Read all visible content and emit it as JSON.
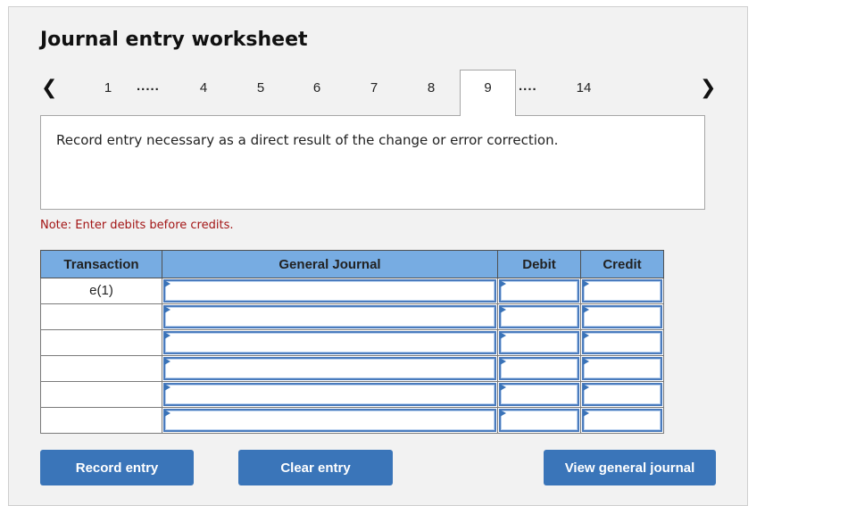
{
  "header": {
    "title": "Journal entry worksheet"
  },
  "pager": {
    "prev_icon": "chevron-left-icon",
    "next_icon": "chevron-right-icon",
    "prev_glyph": "❮",
    "next_glyph": "❯",
    "pages": [
      "1",
      "4",
      "5",
      "6",
      "7",
      "8",
      "9",
      "14"
    ],
    "dots_left": ".....",
    "dots_right": "....",
    "active_page": "9"
  },
  "instruction": "Record entry necessary as a direct result of the change or error correction.",
  "note": "Note: Enter debits before credits.",
  "table": {
    "headers": [
      "Transaction",
      "General Journal",
      "Debit",
      "Credit"
    ],
    "rows": [
      {
        "transaction": "e(1)",
        "account": "",
        "debit": "",
        "credit": ""
      },
      {
        "transaction": "",
        "account": "",
        "debit": "",
        "credit": ""
      },
      {
        "transaction": "",
        "account": "",
        "debit": "",
        "credit": ""
      },
      {
        "transaction": "",
        "account": "",
        "debit": "",
        "credit": ""
      },
      {
        "transaction": "",
        "account": "",
        "debit": "",
        "credit": ""
      },
      {
        "transaction": "",
        "account": "",
        "debit": "",
        "credit": ""
      }
    ]
  },
  "buttons": {
    "record": "Record entry",
    "clear": "Clear entry",
    "view": "View general journal"
  },
  "colors": {
    "header_bg": "#77ace2",
    "button_bg": "#3a75b9",
    "note_text": "#a31515",
    "input_border": "#4a7bbd"
  }
}
